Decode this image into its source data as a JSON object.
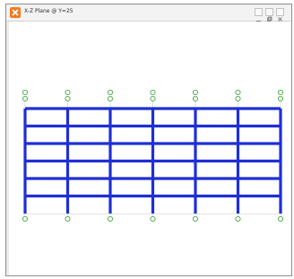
{
  "window": {
    "title": "X-Z Plane @ Y=25",
    "buttons": [
      "minimize",
      "restore",
      "close"
    ]
  },
  "model": {
    "view": "X-Z elevation",
    "grid_count": 7,
    "story_count": 6,
    "bay_count": 6,
    "colors": {
      "frame": "#1f2fd6",
      "grid_bubble": "#2e9f2e",
      "grid_line": "#c7c7c7",
      "window_border": "#8f8f8f"
    }
  }
}
